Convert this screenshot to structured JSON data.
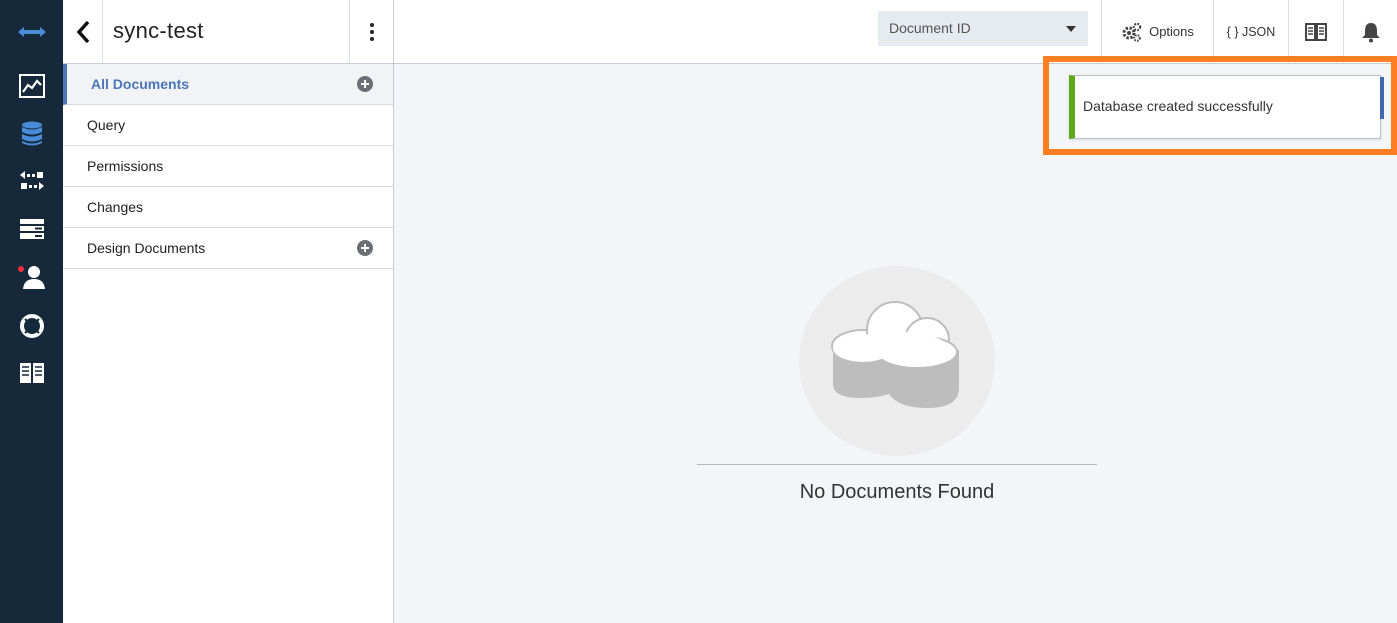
{
  "app": {
    "database_name": "sync-test"
  },
  "rail": {
    "icons": [
      "databases-arrows-icon",
      "activity-chart-icon",
      "database-icon",
      "replication-icon",
      "config-server-icon",
      "user-icon",
      "support-lifebuoy-icon",
      "documentation-book-icon"
    ],
    "accent": "#4a8bd8",
    "notification_dot_color": "#e8313a"
  },
  "header": {
    "document_id_select": {
      "selected": "Document ID"
    },
    "options_label": "Options",
    "json_label": "{ } JSON"
  },
  "sidebar": {
    "items": [
      {
        "label": "All Documents",
        "active": true,
        "has_add": true
      },
      {
        "label": "Query",
        "active": false,
        "has_add": false
      },
      {
        "label": "Permissions",
        "active": false,
        "has_add": false
      },
      {
        "label": "Changes",
        "active": false,
        "has_add": false
      },
      {
        "label": "Design Documents",
        "active": false,
        "has_add": true
      }
    ]
  },
  "main": {
    "empty_message": "No Documents Found"
  },
  "notification": {
    "message": "Database created successfully",
    "status_color": "#5ea81e",
    "highlight_color": "#ff7e22"
  }
}
